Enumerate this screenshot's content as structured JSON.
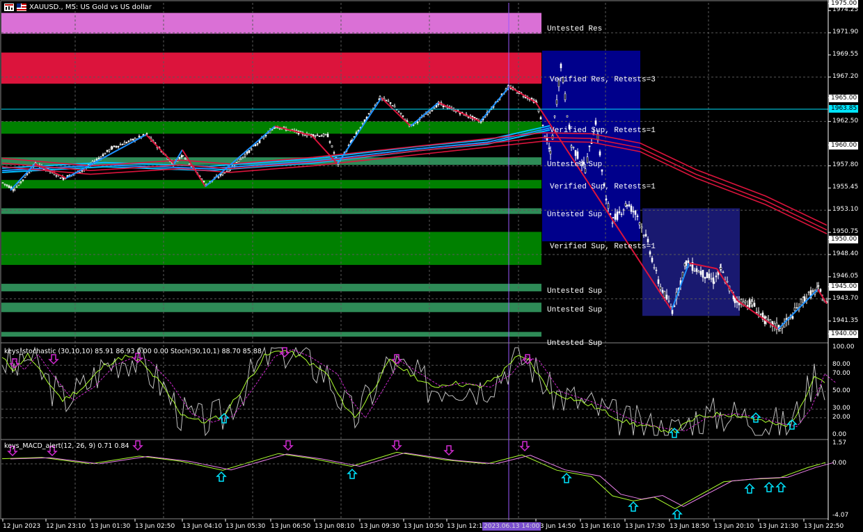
{
  "window": {
    "title": "XAUUSD., M5:  US Gold vs US dollar"
  },
  "colors": {
    "background": "#000000",
    "grid": "#5a5a5a",
    "bull_candle": "#ffffff",
    "bear_candle": "#ffffff",
    "resistance_untested": "#da70d6",
    "resistance_verified": "#dc143c",
    "support_verified": "#008000",
    "support_untested": "#2e8b57",
    "blue_box": "#00008b",
    "midnight_box": "#191970",
    "ma_blue": "#1e90ff",
    "ma_red": "#dc143c",
    "cursor_line": "#9b59ff",
    "bid_line": "#00e5ff",
    "stoch_main": "#c0c0c0",
    "stoch_signal": "#d02ad0",
    "macd_main": "#adff2f",
    "macd_signal": "#ee82ee",
    "arrow_down": "#d02ad0",
    "arrow_up": "#00e5ff"
  },
  "price_axis": {
    "labels": [
      "1975.00",
      "1974.25",
      "1971.90",
      "1969.55",
      "1967.20",
      "1965.00",
      "1962.50",
      "1960.00",
      "1957.80",
      "1955.45",
      "1953.10",
      "1950.75",
      "1950.00",
      "1948.40",
      "1946.05",
      "1945.00",
      "1943.70",
      "1941.35",
      "1940.00"
    ],
    "boxed": [
      "1975.00",
      "1970.00",
      "1965.00",
      "1960.00",
      "1955.00",
      "1950.00",
      "1945.00",
      "1940.00"
    ],
    "bid_label": "1963.85",
    "range": [
      1939.2,
      1975.4
    ]
  },
  "stoch_axis": {
    "labels": [
      "100.00",
      "80.00",
      "70.00",
      "50.00",
      "30.00",
      "20.00",
      "0.00"
    ]
  },
  "macd_axis": {
    "labels": [
      "1.57",
      "0.00",
      "-4.07"
    ]
  },
  "time_axis": {
    "labels": [
      "12 Jun 2023",
      "12 Jun 23:10",
      "13 Jun 01:30",
      "13 Jun 02:50",
      "13 Jun 04:10",
      "13 Jun 05:30",
      "13 Jun 06:50",
      "13 Jun 08:10",
      "13 Jun 09:30",
      "13 Jun 10:50",
      "13 Jun 12:10",
      "13 Jun 14:50",
      "13 Jun 16:10",
      "13 Jun 17:30",
      "13 Jun 18:50",
      "13 Jun 20:10",
      "13 Jun 21:30",
      "13 Jun 22:50"
    ],
    "cursor_label": "2023.06.13 14:00"
  },
  "zones": {
    "labels": [
      "Untested Res",
      "Verified Res, Retests=3",
      "Verified Sup, Retests=1",
      "Untested Sup",
      "Verified Sup, Retests=1",
      "Untested Sup",
      "Verified Sup, Retests=1",
      "Untested Sup",
      "Untested Sup",
      "Untested Sup"
    ]
  },
  "indicators": {
    "stoch_label": "keys_stochastic (30,10,10) 85.91 86.93 0.00 0.00 Stoch(30,10,1) 88.70 85.88",
    "macd_label": "keys_MACD_alert(12, 26, 9) 0.71 0.84"
  }
}
